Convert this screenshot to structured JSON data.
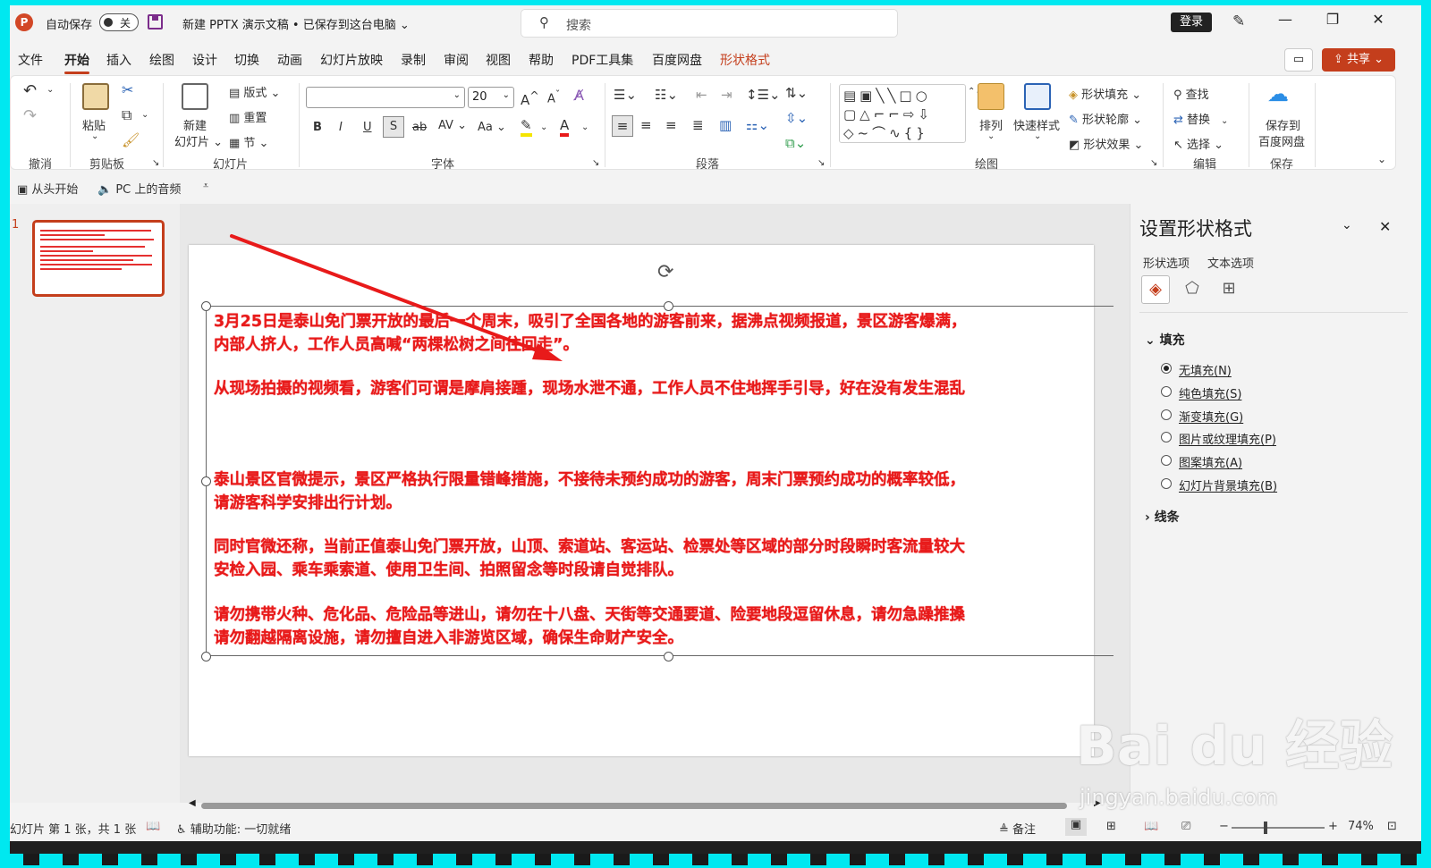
{
  "titlebar": {
    "logo": "P",
    "autosave_label": "自动保存",
    "autosave_state": "关",
    "doc_title": "新建 PPTX 演示文稿 • 已保存到这台电脑 ⌄",
    "search_placeholder": "搜索",
    "login": "登录",
    "minimize": "—",
    "restore": "❐",
    "close": "✕"
  },
  "tabs": [
    "文件",
    "开始",
    "插入",
    "绘图",
    "设计",
    "切换",
    "动画",
    "幻灯片放映",
    "录制",
    "审阅",
    "视图",
    "帮助",
    "PDF工具集",
    "百度网盘",
    "形状格式"
  ],
  "active_tab": "开始",
  "share": "共享 ⌄",
  "ribbon": {
    "groups": {
      "undo": "撤消",
      "clipboard": "剪贴板",
      "slides": "幻灯片",
      "font": "字体",
      "paragraph": "段落",
      "drawing": "绘图",
      "edit": "编辑",
      "save": "保存"
    },
    "paste": "粘贴",
    "new_slide_1": "新建",
    "new_slide_2": "幻灯片 ⌄",
    "layout": "版式 ⌄",
    "reset": "重置",
    "section": "节 ⌄",
    "font_size": "20",
    "arrange": "排列",
    "quick_styles": "快速样式",
    "shape_fill": "形状填充 ⌄",
    "shape_outline": "形状轮廓 ⌄",
    "shape_effects": "形状效果 ⌄",
    "find": "查找",
    "replace": "替换",
    "select": "选择 ⌄",
    "save_to_1": "保存到",
    "save_to_2": "百度网盘"
  },
  "qat": {
    "from_start": "从头开始",
    "audio": "PC 上的音频"
  },
  "thumbnail_number": "1",
  "slide_paragraphs": [
    "3月25日是泰山免门票开放的最后一个周末，吸引了全国各地的游客前来，据沸点视频报道，景区游客爆满，",
    "内部人挤人，工作人员高喊“两棵松树之间往回走”。",
    "从现场拍摄的视频看，游客们可谓是摩肩接踵，现场水泄不通，工作人员不住地挥手引导，好在没有发生混乱",
    "泰山景区官微提示，景区严格执行限量错峰措施，不接待未预约成功的游客，周末门票预约成功的概率较低，",
    "请游客科学安排出行计划。",
    "同时官微还称，当前正值泰山免门票开放，山顶、索道站、客运站、检票处等区域的部分时段瞬时客流量较大",
    "安检入园、乘车乘索道、使用卫生间、拍照留念等时段请自觉排队。",
    "请勿携带火种、危化品、危险品等进山，请勿在十八盘、天街等交通要道、险要地段逗留休息，请勿急躁推搡",
    "请勿翻越隔离设施，请勿擅自进入非游览区域，确保生命财产安全。"
  ],
  "pane": {
    "title": "设置形状格式",
    "tab_shape": "形状选项",
    "tab_text": "文本选项",
    "fill_section": "填充",
    "line_section": "线条",
    "fill_options": [
      "无填充(N)",
      "纯色填充(S)",
      "渐变填充(G)",
      "图片或纹理填充(P)",
      "图案填充(A)",
      "幻灯片背景填充(B)"
    ],
    "selected_fill": "无填充(N)"
  },
  "status": {
    "slide_info": "幻灯片 第 1 张，共 1 张",
    "accessibility": "辅助功能: 一切就绪",
    "notes": "备注",
    "zoom": "74%"
  },
  "watermark": {
    "main": "Bai du 经验",
    "sub": "jingyan.baidu.com"
  },
  "colors": {
    "accent": "#c43e1c",
    "slide_text": "#e81a1a",
    "arrow": "#e81a1a",
    "frame": "#00e8f0"
  }
}
